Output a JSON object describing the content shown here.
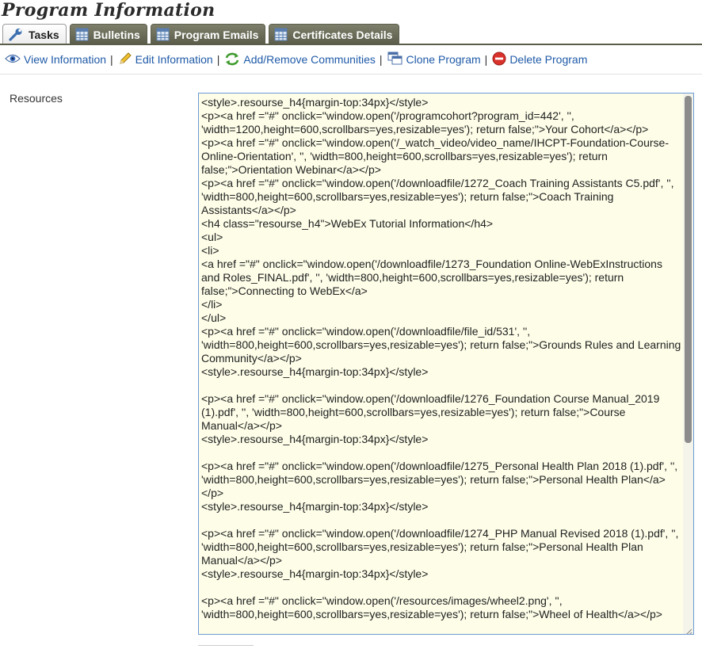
{
  "page": {
    "title": "Program Information"
  },
  "tabs": [
    {
      "label": "Tasks",
      "icon": "wrench-icon",
      "active": true
    },
    {
      "label": "Bulletins",
      "icon": "table-icon",
      "active": false
    },
    {
      "label": "Program Emails",
      "icon": "table-icon",
      "active": false
    },
    {
      "label": "Certificates Details",
      "icon": "table-icon",
      "active": false
    }
  ],
  "toolbar": {
    "view": "View Information",
    "edit": "Edit Information",
    "communities": "Add/Remove Communities",
    "clone": "Clone Program",
    "delete": "Delete Program",
    "separator": "|"
  },
  "form": {
    "resources_label": "Resources",
    "resources_value": "<style>.resourse_h4{margin-top:34px}</style>\n<p><a href =\"#\" onclick=\"window.open('/programcohort?program_id=442', '', 'width=1200,height=600,scrollbars=yes,resizable=yes'); return false;\">Your Cohort</a></p>\n<p><a href =\"#\" onclick=\"window.open('/_watch_video/video_name/IHCPT-Foundation-Course-Online-Orientation', '', 'width=800,height=600,scrollbars=yes,resizable=yes'); return false;\">Orientation Webinar</a></p>\n<p><a href =\"#\" onclick=\"window.open('/downloadfile/1272_Coach Training Assistants C5.pdf', '', 'width=800,height=600,scrollbars=yes,resizable=yes'); return false;\">Coach Training Assistants</a></p>\n<h4 class=\"resourse_h4\">WebEx Tutorial Information</h4>\n<ul>\n<li>\n<a href =\"#\" onclick=\"window.open('/downloadfile/1273_Foundation Online-WebExInstructions and Roles_FINAL.pdf', '', 'width=800,height=600,scrollbars=yes,resizable=yes'); return false;\">Connecting to WebEx</a>\n</li>\n</ul>\n<p><a href =\"#\" onclick=\"window.open('/downloadfile/file_id/531', '', 'width=800,height=600,scrollbars=yes,resizable=yes'); return false;\">Grounds Rules and Learning Community</a></p>\n<style>.resourse_h4{margin-top:34px}</style>\n\n<p><a href =\"#\" onclick=\"window.open('/downloadfile/1276_Foundation Course Manual_2019 (1).pdf', '', 'width=800,height=600,scrollbars=yes,resizable=yes'); return false;\">Course Manual</a></p>\n<style>.resourse_h4{margin-top:34px}</style>\n\n<p><a href =\"#\" onclick=\"window.open('/downloadfile/1275_Personal Health Plan 2018 (1).pdf', '', 'width=800,height=600,scrollbars=yes,resizable=yes'); return false;\">Personal Health Plan</a></p>\n<style>.resourse_h4{margin-top:34px}</style>\n\n<p><a href =\"#\" onclick=\"window.open('/downloadfile/1274_PHP Manual Revised 2018 (1).pdf', '', 'width=800,height=600,scrollbars=yes,resizable=yes'); return false;\">Personal Health Plan Manual</a></p>\n<style>.resourse_h4{margin-top:34px}</style>\n\n<p><a href =\"#\" onclick=\"window.open('/resources/images/wheel2.png', '', 'width=800,height=600,scrollbars=yes,resizable=yes'); return false;\">Wheel of Health</a></p>"
  },
  "colors": {
    "link": "#1f5aa8",
    "tab_bg": "#5b5d4a",
    "textarea_bg": "#fdfde8",
    "textarea_border": "#6b9bd2"
  }
}
